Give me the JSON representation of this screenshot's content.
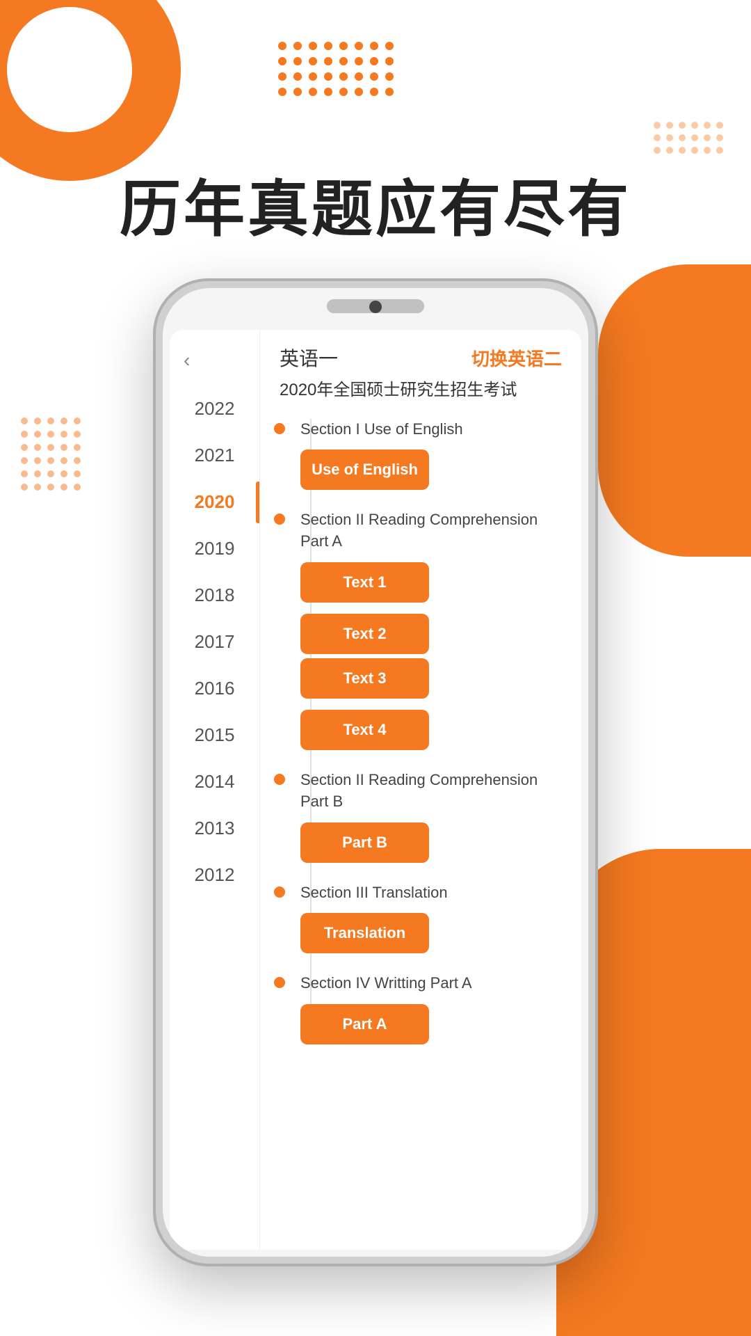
{
  "hero": {
    "title": "历年真题应有尽有"
  },
  "phone": {
    "header": {
      "title_cn": "英语一",
      "switch_label": "切换英语二",
      "exam_title": "2020年全国硕士研究生招生考试"
    },
    "years": [
      {
        "year": "2022",
        "active": false
      },
      {
        "year": "2021",
        "active": false
      },
      {
        "year": "2020",
        "active": true
      },
      {
        "year": "2019",
        "active": false
      },
      {
        "year": "2018",
        "active": false
      },
      {
        "year": "2017",
        "active": false
      },
      {
        "year": "2016",
        "active": false
      },
      {
        "year": "2015",
        "active": false
      },
      {
        "year": "2014",
        "active": false
      },
      {
        "year": "2013",
        "active": false
      },
      {
        "year": "2012",
        "active": false
      }
    ],
    "sections": [
      {
        "label": "Section I Use of English",
        "buttons": [
          {
            "text": "Use of English"
          }
        ]
      },
      {
        "label": "Section II Reading Comprehension Part A",
        "buttons": [
          {
            "text": "Text 1"
          },
          {
            "text": "Text 2"
          },
          {
            "text": "Text 3"
          },
          {
            "text": "Text 4"
          }
        ]
      },
      {
        "label": "Section II Reading Comprehension Part B",
        "buttons": [
          {
            "text": "Part B"
          }
        ]
      },
      {
        "label": "Section III Translation",
        "buttons": [
          {
            "text": "Translation"
          }
        ]
      },
      {
        "label": "Section IV Writting Part A",
        "buttons": [
          {
            "text": "Part A"
          }
        ]
      }
    ]
  },
  "colors": {
    "orange": "#F47920",
    "text_dark": "#222",
    "text_gray": "#555"
  }
}
